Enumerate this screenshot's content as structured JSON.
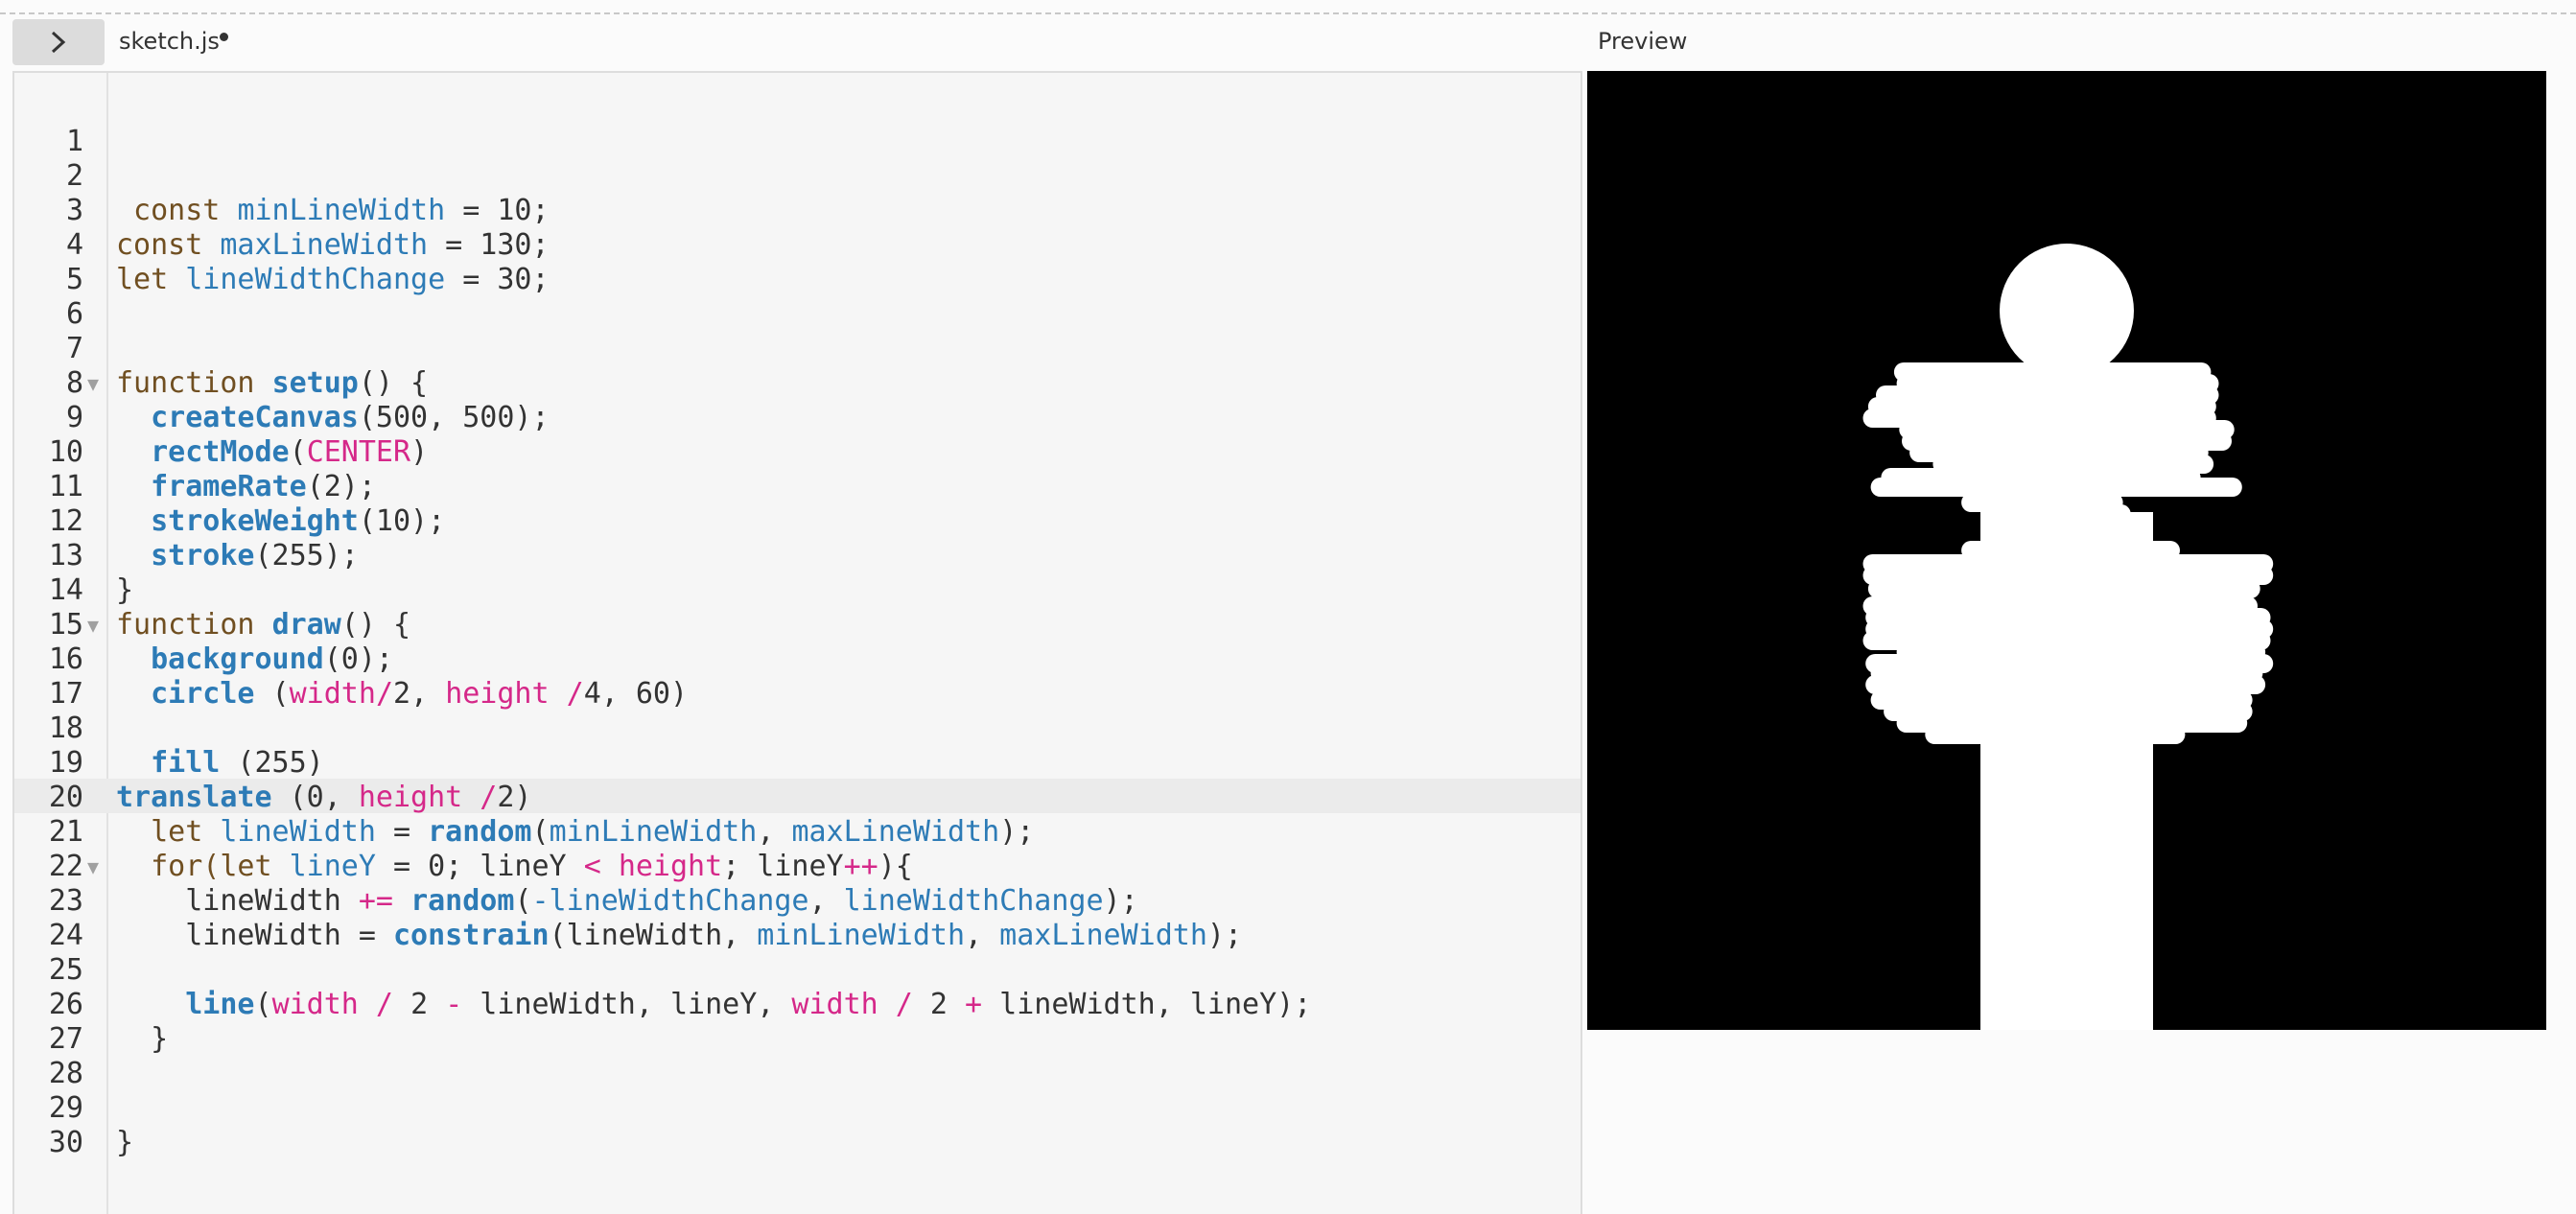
{
  "toolbar": {
    "toggle_icon": "chevron-right-icon"
  },
  "file_tab": {
    "name": "sketch.js",
    "unsaved": true
  },
  "preview": {
    "label": "Preview",
    "canvas_background": "#000000",
    "stroke_color": "#ffffff"
  },
  "editor": {
    "active_line": 20,
    "line_numbers": [
      "1",
      "2",
      "3",
      "4",
      "5",
      "6",
      "7",
      "8",
      "9",
      "10",
      "11",
      "12",
      "13",
      "14",
      "15",
      "16",
      "17",
      "18",
      "19",
      "20",
      "21",
      "22",
      "23",
      "24",
      "25",
      "26",
      "27",
      "28",
      "29",
      "30"
    ],
    "fold_marker": "▼",
    "fold_lines": [
      8,
      15,
      22
    ],
    "code": [
      [],
      [],
      [
        {
          "t": " const ",
          "c": "kw"
        },
        {
          "t": "minLineWidth",
          "c": "var"
        },
        {
          "t": " = 10;",
          "c": "num"
        }
      ],
      [
        {
          "t": "const ",
          "c": "kw"
        },
        {
          "t": "maxLineWidth",
          "c": "var"
        },
        {
          "t": " = 130;",
          "c": "num"
        }
      ],
      [
        {
          "t": "let ",
          "c": "kw"
        },
        {
          "t": "lineWidthChange",
          "c": "var"
        },
        {
          "t": " = 30;",
          "c": "num"
        }
      ],
      [],
      [],
      [
        {
          "t": "function ",
          "c": "kw"
        },
        {
          "t": "setup",
          "c": "fn"
        },
        {
          "t": "() {",
          "c": "num"
        }
      ],
      [
        {
          "t": "  ",
          "c": "num"
        },
        {
          "t": "createCanvas",
          "c": "fn"
        },
        {
          "t": "(500, 500);",
          "c": "num"
        }
      ],
      [
        {
          "t": "  ",
          "c": "num"
        },
        {
          "t": "rectMode",
          "c": "fn"
        },
        {
          "t": "(",
          "c": "num"
        },
        {
          "t": "CENTER",
          "c": "const"
        },
        {
          "t": ")",
          "c": "num"
        }
      ],
      [
        {
          "t": "  ",
          "c": "num"
        },
        {
          "t": "frameRate",
          "c": "fn"
        },
        {
          "t": "(2);",
          "c": "num"
        }
      ],
      [
        {
          "t": "  ",
          "c": "num"
        },
        {
          "t": "strokeWeight",
          "c": "fn"
        },
        {
          "t": "(10);",
          "c": "num"
        }
      ],
      [
        {
          "t": "  ",
          "c": "num"
        },
        {
          "t": "stroke",
          "c": "fn"
        },
        {
          "t": "(255);",
          "c": "num"
        }
      ],
      [
        {
          "t": "}",
          "c": "num"
        }
      ],
      [
        {
          "t": "function ",
          "c": "kw"
        },
        {
          "t": "draw",
          "c": "fn"
        },
        {
          "t": "() {",
          "c": "num"
        }
      ],
      [
        {
          "t": "  ",
          "c": "num"
        },
        {
          "t": "background",
          "c": "fn"
        },
        {
          "t": "(0);",
          "c": "num"
        }
      ],
      [
        {
          "t": "  ",
          "c": "num"
        },
        {
          "t": "circle",
          "c": "fn"
        },
        {
          "t": " (",
          "c": "num"
        },
        {
          "t": "width",
          "c": "const"
        },
        {
          "t": "/",
          "c": "op"
        },
        {
          "t": "2, ",
          "c": "num"
        },
        {
          "t": "height",
          "c": "const"
        },
        {
          "t": " /",
          "c": "op"
        },
        {
          "t": "4, 60)",
          "c": "num"
        }
      ],
      [],
      [
        {
          "t": "  ",
          "c": "num"
        },
        {
          "t": "fill",
          "c": "fn"
        },
        {
          "t": " (255)",
          "c": "num"
        }
      ],
      [
        {
          "t": "translate",
          "c": "fn"
        },
        {
          "t": " (0, ",
          "c": "num"
        },
        {
          "t": "height",
          "c": "const"
        },
        {
          "t": " /",
          "c": "op"
        },
        {
          "t": "2)",
          "c": "num"
        }
      ],
      [
        {
          "t": "  let ",
          "c": "kw"
        },
        {
          "t": "lineWidth",
          "c": "var"
        },
        {
          "t": " = ",
          "c": "num"
        },
        {
          "t": "random",
          "c": "fn"
        },
        {
          "t": "(",
          "c": "num"
        },
        {
          "t": "minLineWidth",
          "c": "var"
        },
        {
          "t": ", ",
          "c": "num"
        },
        {
          "t": "maxLineWidth",
          "c": "var"
        },
        {
          "t": ");",
          "c": "num"
        }
      ],
      [
        {
          "t": "  for(let ",
          "c": "kw"
        },
        {
          "t": "lineY",
          "c": "var"
        },
        {
          "t": " = 0; lineY ",
          "c": "num"
        },
        {
          "t": "<",
          "c": "op"
        },
        {
          "t": " ",
          "c": "num"
        },
        {
          "t": "height",
          "c": "const"
        },
        {
          "t": "; lineY",
          "c": "num"
        },
        {
          "t": "++",
          "c": "op"
        },
        {
          "t": "){",
          "c": "num"
        }
      ],
      [
        {
          "t": "    lineWidth ",
          "c": "num"
        },
        {
          "t": "+=",
          "c": "op"
        },
        {
          "t": " ",
          "c": "num"
        },
        {
          "t": "random",
          "c": "fn"
        },
        {
          "t": "(",
          "c": "num"
        },
        {
          "t": "-lineWidthChange",
          "c": "var"
        },
        {
          "t": ", ",
          "c": "num"
        },
        {
          "t": "lineWidthChange",
          "c": "var"
        },
        {
          "t": ");",
          "c": "num"
        }
      ],
      [
        {
          "t": "    lineWidth = ",
          "c": "num"
        },
        {
          "t": "constrain",
          "c": "fn"
        },
        {
          "t": "(lineWidth, ",
          "c": "num"
        },
        {
          "t": "minLineWidth",
          "c": "var"
        },
        {
          "t": ", ",
          "c": "num"
        },
        {
          "t": "maxLineWidth",
          "c": "var"
        },
        {
          "t": ");",
          "c": "num"
        }
      ],
      [],
      [
        {
          "t": "    ",
          "c": "num"
        },
        {
          "t": "line",
          "c": "fn"
        },
        {
          "t": "(",
          "c": "num"
        },
        {
          "t": "width",
          "c": "const"
        },
        {
          "t": " / ",
          "c": "op"
        },
        {
          "t": "2 ",
          "c": "num"
        },
        {
          "t": "-",
          "c": "op"
        },
        {
          "t": " lineWidth, lineY, ",
          "c": "num"
        },
        {
          "t": "width",
          "c": "const"
        },
        {
          "t": " / ",
          "c": "op"
        },
        {
          "t": "2 ",
          "c": "num"
        },
        {
          "t": "+",
          "c": "op"
        },
        {
          "t": " lineWidth, lineY);",
          "c": "num"
        }
      ],
      [
        {
          "t": "  }",
          "c": "num"
        }
      ],
      [],
      [],
      [
        {
          "t": "}",
          "c": "num"
        }
      ]
    ]
  }
}
